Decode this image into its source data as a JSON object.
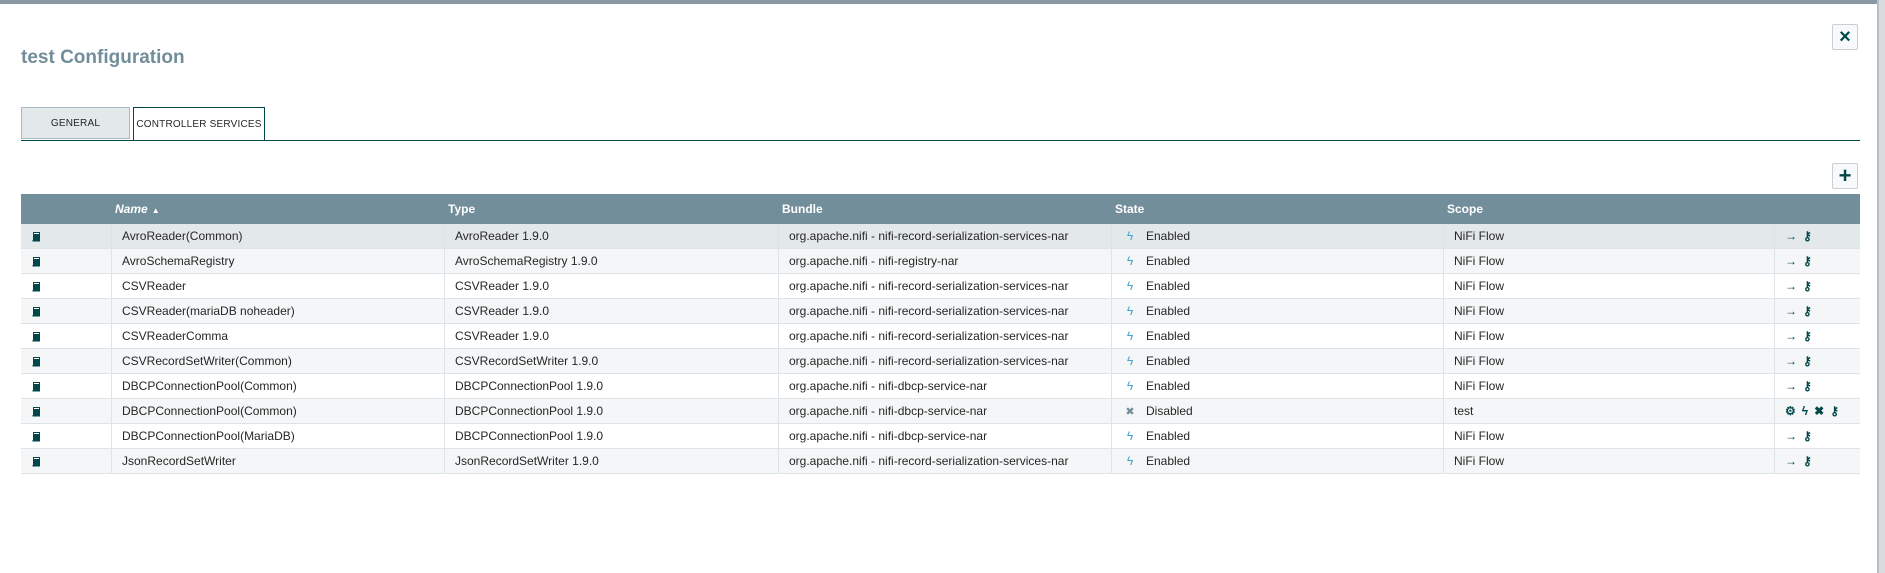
{
  "dialog": {
    "title": "test Configuration",
    "close_label": "×"
  },
  "tabs": [
    {
      "label": "GENERAL"
    },
    {
      "label": "CONTROLLER SERVICES"
    }
  ],
  "add_label": "+",
  "columns": {
    "name": "Name",
    "sort": "▲",
    "type": "Type",
    "bundle": "Bundle",
    "state": "State",
    "scope": "Scope"
  },
  "icons": {
    "service": "book-icon",
    "enabled": "bolt-icon",
    "disabled": "disabled-icon",
    "goto": "arrow-right-icon",
    "access": "key-icon",
    "configure": "gear-icon",
    "enable": "bolt-icon",
    "remove": "trash-icon"
  },
  "colors": {
    "header": "#728e9b",
    "accent": "#004849",
    "enabled": "#44a3cf"
  },
  "rows": [
    {
      "name": "AvroReader(Common)",
      "type": "AvroReader 1.9.0",
      "bundle": "org.apache.nifi - nifi-record-serialization-services-nar",
      "state": "Enabled",
      "scope": "NiFi Flow"
    },
    {
      "name": "AvroSchemaRegistry",
      "type": "AvroSchemaRegistry 1.9.0",
      "bundle": "org.apache.nifi - nifi-registry-nar",
      "state": "Enabled",
      "scope": "NiFi Flow"
    },
    {
      "name": "CSVReader",
      "type": "CSVReader 1.9.0",
      "bundle": "org.apache.nifi - nifi-record-serialization-services-nar",
      "state": "Enabled",
      "scope": "NiFi Flow"
    },
    {
      "name": "CSVReader(mariaDB noheader)",
      "type": "CSVReader 1.9.0",
      "bundle": "org.apache.nifi - nifi-record-serialization-services-nar",
      "state": "Enabled",
      "scope": "NiFi Flow"
    },
    {
      "name": "CSVReaderComma",
      "type": "CSVReader 1.9.0",
      "bundle": "org.apache.nifi - nifi-record-serialization-services-nar",
      "state": "Enabled",
      "scope": "NiFi Flow"
    },
    {
      "name": "CSVRecordSetWriter(Common)",
      "type": "CSVRecordSetWriter 1.9.0",
      "bundle": "org.apache.nifi - nifi-record-serialization-services-nar",
      "state": "Enabled",
      "scope": "NiFi Flow"
    },
    {
      "name": "DBCPConnectionPool(Common)",
      "type": "DBCPConnectionPool 1.9.0",
      "bundle": "org.apache.nifi - nifi-dbcp-service-nar",
      "state": "Enabled",
      "scope": "NiFi Flow"
    },
    {
      "name": "DBCPConnectionPool(Common)",
      "type": "DBCPConnectionPool 1.9.0",
      "bundle": "org.apache.nifi - nifi-dbcp-service-nar",
      "state": "Disabled",
      "scope": "test"
    },
    {
      "name": "DBCPConnectionPool(MariaDB)",
      "type": "DBCPConnectionPool 1.9.0",
      "bundle": "org.apache.nifi - nifi-dbcp-service-nar",
      "state": "Enabled",
      "scope": "NiFi Flow"
    },
    {
      "name": "JsonRecordSetWriter",
      "type": "JsonRecordSetWriter 1.9.0",
      "bundle": "org.apache.nifi - nifi-record-serialization-services-nar",
      "state": "Enabled",
      "scope": "NiFi Flow"
    }
  ]
}
